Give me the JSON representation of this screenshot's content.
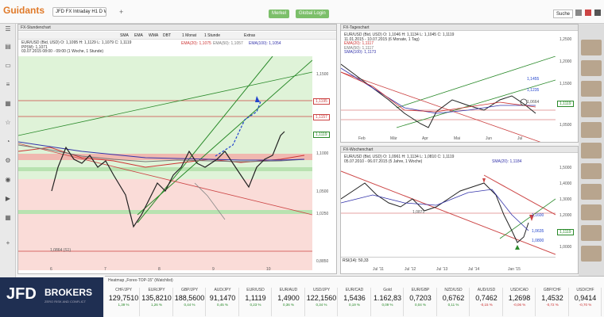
{
  "app": {
    "logo": "Guidants",
    "tab": "JFD FX Intraday H1 D W",
    "watch_btn": "Merkel",
    "market_btn": "Global Login",
    "search_btn": "Suche"
  },
  "sidebar": {
    "icons": [
      "menu-icon",
      "chart-icon",
      "monitor-icon",
      "list-icon",
      "news-icon",
      "star-icon",
      "bell-icon",
      "settings-icon",
      "user-icon",
      "arrow-icon",
      "grid-icon",
      "plus-icon"
    ]
  },
  "panel1": {
    "title": "FX-Stundenchart",
    "toolbar": [
      "SMA",
      "EMA",
      "WMA",
      "DBT",
      "1 Monat",
      "1 Stunde",
      "Extras"
    ],
    "info": [
      "EUR/USD (Bid, USD) O: 1,1095 H: 1,1129 L: 1,1079 C: 1,1119",
      "PP(W): 1,1071",
      "03.07.2015 08:00 - 09:00 (1 Woche, 1 Stunde)"
    ],
    "legend": [
      "EMA(20): 1,1075",
      "EMA(50): 1,1057",
      "EMA(100): 1,1054"
    ],
    "levels": [
      "1,1195",
      "1,1157",
      "1,1119",
      "1,0864 (S1)"
    ],
    "yticks": [
      "1,1500",
      "1,1250",
      "1,1000",
      "1,0750",
      "1,0500",
      "1,0250",
      "1,0000",
      "0,8850"
    ],
    "xticks": [
      "6",
      "7",
      "8",
      "9",
      "10"
    ]
  },
  "panel2": {
    "title": "FX-Tageschart",
    "info": [
      "EUR/USD (Bid, USD) O: 1,1046 H: 1,1134 L: 1,1045 C: 1,1119",
      "11.01.2015 - 10.07.2015 (6 Monate, 1 Tag)",
      "EMA(20): 1,1117",
      "EMA(50): 1,1117",
      "SMA(100): 1,1173"
    ],
    "labels": [
      "1,1455",
      "1,1235",
      "1,0664",
      "1,1119"
    ],
    "yticks": [
      "1,2500",
      "1,2000",
      "1,1500",
      "1,1000",
      "1,0500"
    ],
    "xticks": [
      "Feb",
      "Mär",
      "Apr",
      "Mai",
      "Jun",
      "Jul"
    ]
  },
  "panel3": {
    "title": "FX-Wochenchart",
    "info": [
      "EUR/USD (Bid, USD) O: 1,0961 H: 1,1134 L: 1,0810 C: 1,1119",
      "05.07.2010 - 06.07.2015 (5 Jahre, 1 Woche)"
    ],
    "legend": "SMA(20): 1,1184",
    "labels": [
      "1,0871",
      "1,1600",
      "1,0635",
      "1,0800",
      "1,1119"
    ],
    "yticks": [
      "1,5000",
      "1,4000",
      "1,3000",
      "1,2000",
      "1,1000",
      "1,0000"
    ],
    "xticks": [
      "Jul '11",
      "Jul '12",
      "Jul '13",
      "Jul '14",
      "Jan '15"
    ],
    "osc": "RSI(14): 50,33"
  },
  "ticker": {
    "header": "Heatmap „Forex-TOP-15“ (Watchlist)",
    "items": [
      {
        "name": "CHF/JPY",
        "val": "129,7510",
        "sub": "1,39 %",
        "color": "#2a8a2a"
      },
      {
        "name": "EUR/JPY",
        "val": "135,8210",
        "sub": "1,26 %",
        "color": "#2a8a2a"
      },
      {
        "name": "GBP/JPY",
        "val": "188,5600",
        "sub": "0,44 %",
        "color": "#2a8a2a"
      },
      {
        "name": "AUD/JPY",
        "val": "91,1470",
        "sub": "0,45 %",
        "color": "#2a8a2a"
      },
      {
        "name": "EUR/USD",
        "val": "1,1119",
        "sub": "0,23 %",
        "color": "#2a8a2a"
      },
      {
        "name": "EUR/AUD",
        "val": "1,4900",
        "sub": "0,36 %",
        "color": "#2a8a2a"
      },
      {
        "name": "USD/JPY",
        "val": "122,1560",
        "sub": "0,34 %",
        "color": "#2a8a2a"
      },
      {
        "name": "EUR/CAD",
        "val": "1,5436",
        "sub": "0,19 %",
        "color": "#2a8a2a"
      },
      {
        "name": "Gold",
        "val": "1.162,83",
        "sub": "0,09 %",
        "color": "#2a8a2a"
      },
      {
        "name": "EUR/GBP",
        "val": "0,7203",
        "sub": "0,04 %",
        "color": "#2a8a2a"
      },
      {
        "name": "NZD/USD",
        "val": "0,6762",
        "sub": "0,11 %",
        "color": "#2a8a2a"
      },
      {
        "name": "AUD/USD",
        "val": "0,7462",
        "sub": "-0,15 %",
        "color": "#c33"
      },
      {
        "name": "USD/CAD",
        "val": "1,2698",
        "sub": "-0,06 %",
        "color": "#c33"
      },
      {
        "name": "GBP/CHF",
        "val": "1,4532",
        "sub": "-0,72 %",
        "color": "#c33"
      },
      {
        "name": "USD/CHF",
        "val": "0,9414",
        "sub": "-0,70 %",
        "color": "#c33"
      }
    ]
  },
  "jfd": {
    "brand": "JFD",
    "brokers": "BROKERS",
    "tagline": "ZERO RISK AND CONFLICT"
  }
}
